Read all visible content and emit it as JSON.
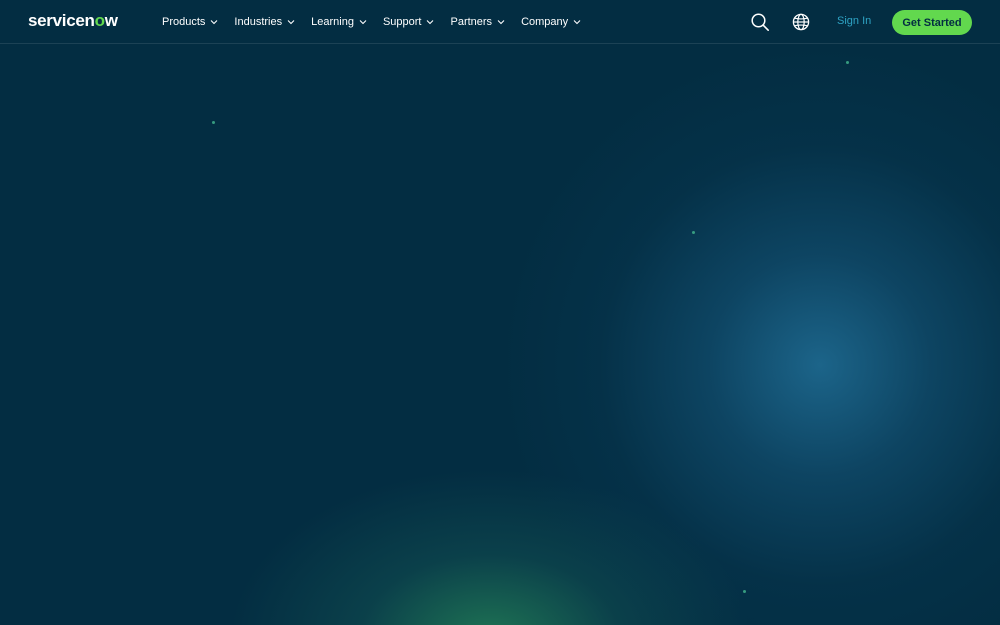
{
  "brand": {
    "logo_prefix": "servicen",
    "logo_o": "o",
    "logo_suffix": "w",
    "accent": "#62d84e"
  },
  "nav": {
    "items": [
      {
        "label": "Products"
      },
      {
        "label": "Industries"
      },
      {
        "label": "Learning"
      },
      {
        "label": "Support"
      },
      {
        "label": "Partners"
      },
      {
        "label": "Company"
      }
    ]
  },
  "header_actions": {
    "search_icon": "search-icon",
    "globe_icon": "globe-icon",
    "sign_in_label": "Sign In",
    "get_started_label": "Get Started"
  },
  "colors": {
    "background": "#032d42",
    "sign_in": "#2ea3c4",
    "cta": "#62d84e"
  }
}
